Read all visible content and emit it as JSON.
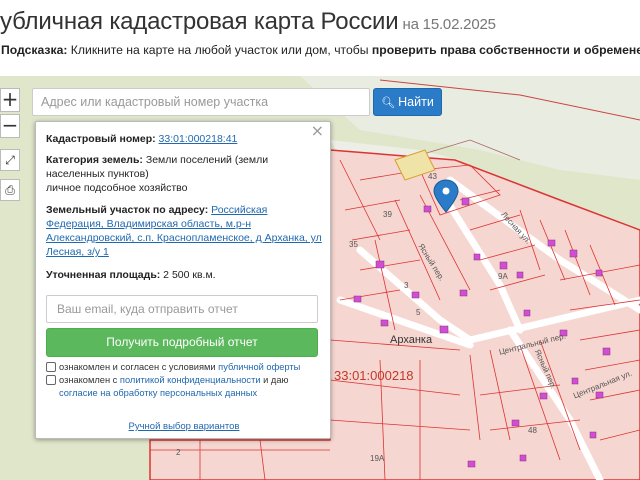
{
  "header": {
    "title": "убличная кадастровая карта России",
    "date": "на 15.02.2025",
    "hint_label": "Подсказка:",
    "hint_text": " Кликните на карте на любой участок или дом, чтобы ",
    "hint_bold": "проверить права собственности и обременения"
  },
  "controls": {
    "zoom_in": "+",
    "zoom_out": "−",
    "fullscreen_icon": "⤢",
    "print_icon": "⎙"
  },
  "search": {
    "placeholder": "Адрес или кадастровый номер участка",
    "button_label": "Найти",
    "button_icon": "search-icon"
  },
  "popup": {
    "cadastral_label": "Кадастровый номер:",
    "cadastral_value": "33:01:000218:41",
    "category_label": "Категория земель:",
    "category_value": " Земли поселений (земли населенных пунктов)",
    "usage": "личное подсобное хозяйство",
    "address_label": "Земельный участок по адресу:",
    "address_value": "Российская Федерация, Владимирская область, м.р-н Александровский, с.п. Краснопламенское, д Арханка, ул Лесная, з/у 1",
    "area_label": "Уточненная площадь:",
    "area_value": " 2 500 кв.м.",
    "email_placeholder": "Ваш email, куда отправить отчет",
    "report_button": "Получить подробный отчет",
    "consent1_pre": "ознакомлен и согласен с условиями ",
    "consent1_link": "публичной оферты",
    "consent2_pre": "ознакомлен с ",
    "consent2_link1": "политикой конфиденциальности",
    "consent2_mid": " и даю ",
    "consent2_link2": "согласие на обработку персональных данных",
    "manual_link": "Ручной выбор вариантов",
    "close": "×"
  },
  "map": {
    "village_label": "Арханка",
    "cadastral_overlay": "33:01:000218",
    "streets": [
      "Ясный пер.",
      "Лесная ул.",
      "Центральный пер.",
      "Ясный пер.",
      "Центральная ул."
    ],
    "parcel_numbers": [
      "43",
      "39",
      "35",
      "3",
      "5",
      "9A",
      "2",
      "19A",
      "48"
    ],
    "colors": {
      "parcel_fill": "#f6d6d0",
      "parcel_border": "#d33",
      "building": "#d04fd0",
      "road": "#ffffff",
      "green": "#dfe6c9",
      "marker": "#2a7bc8"
    }
  }
}
